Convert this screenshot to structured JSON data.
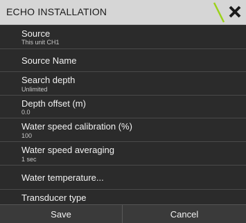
{
  "dialog": {
    "title": "ECHO INSTALLATION",
    "accent_color": "#9bd21a",
    "close_icon": "close-icon"
  },
  "items": [
    {
      "label": "Source",
      "value": "This unit CH1"
    },
    {
      "label": "Source Name",
      "value": ""
    },
    {
      "label": "Search depth",
      "value": "Unlimited"
    },
    {
      "label": "Depth offset (m)",
      "value": "0.0"
    },
    {
      "label": "Water speed calibration (%)",
      "value": "100"
    },
    {
      "label": "Water speed averaging",
      "value": "1 sec"
    },
    {
      "label": "Water temperature...",
      "value": ""
    },
    {
      "label": "Transducer type",
      "value": ""
    }
  ],
  "footer": {
    "save_label": "Save",
    "cancel_label": "Cancel"
  }
}
